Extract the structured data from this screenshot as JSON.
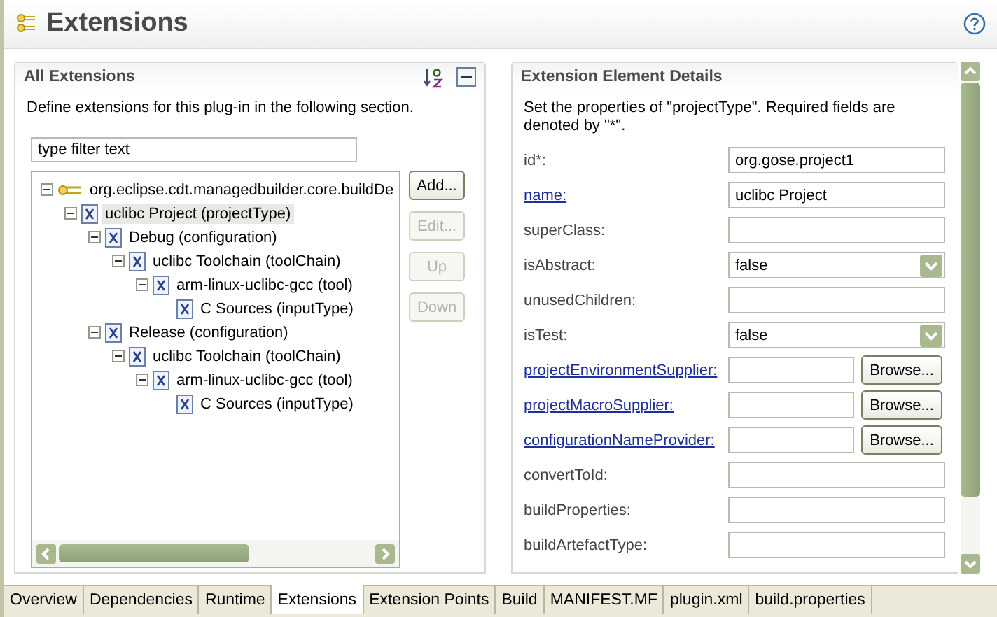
{
  "header": {
    "title": "Extensions"
  },
  "all_extensions": {
    "title": "All Extensions",
    "description": "Define extensions for this plug-in in the following section.",
    "filter": {
      "value": "type filter text"
    },
    "tree": [
      {
        "label": "org.eclipse.cdt.managedbuilder.core.buildDe",
        "kind": "extension",
        "expanded": true,
        "selected": false,
        "children": [
          {
            "label": "uclibc Project (projectType)",
            "kind": "element",
            "expanded": true,
            "selected": true,
            "children": [
              {
                "label": "Debug (configuration)",
                "kind": "element",
                "expanded": true,
                "selected": false,
                "children": [
                  {
                    "label": "uclibc Toolchain (toolChain)",
                    "kind": "element",
                    "expanded": true,
                    "selected": false,
                    "children": [
                      {
                        "label": "arm-linux-uclibc-gcc (tool)",
                        "kind": "element",
                        "expanded": true,
                        "selected": false,
                        "children": [
                          {
                            "label": "C Sources (inputType)",
                            "kind": "element",
                            "selected": false
                          }
                        ]
                      }
                    ]
                  }
                ]
              },
              {
                "label": "Release (configuration)",
                "kind": "element",
                "expanded": true,
                "selected": false,
                "children": [
                  {
                    "label": "uclibc Toolchain (toolChain)",
                    "kind": "element",
                    "expanded": true,
                    "selected": false,
                    "children": [
                      {
                        "label": "arm-linux-uclibc-gcc (tool)",
                        "kind": "element",
                        "expanded": true,
                        "selected": false,
                        "children": [
                          {
                            "label": "C Sources (inputType)",
                            "kind": "element",
                            "selected": false
                          }
                        ]
                      }
                    ]
                  }
                ]
              }
            ]
          }
        ]
      }
    ],
    "buttons": [
      {
        "label": "Add...",
        "disabled": false
      },
      {
        "label": "Edit...",
        "disabled": true
      },
      {
        "label": "Up",
        "disabled": true
      },
      {
        "label": "Down",
        "disabled": true
      }
    ]
  },
  "details": {
    "title": "Extension Element Details",
    "description": "Set the properties of \"projectType\". Required fields are denoted by \"*\".",
    "fields": [
      {
        "label": "id*:",
        "link": false,
        "kind": "text",
        "value": "org.gose.project1"
      },
      {
        "label": "name:",
        "link": true,
        "kind": "text",
        "value": "uclibc Project"
      },
      {
        "label": "superClass:",
        "link": false,
        "kind": "text"
      },
      {
        "label": "isAbstract:",
        "link": false,
        "kind": "combo",
        "value": "false"
      },
      {
        "label": "unusedChildren:",
        "link": false,
        "kind": "text"
      },
      {
        "label": "isTest:",
        "link": false,
        "kind": "combo",
        "value": "false"
      },
      {
        "label": "projectEnvironmentSupplier:",
        "link": true,
        "kind": "browse",
        "button": "Browse..."
      },
      {
        "label": "projectMacroSupplier:",
        "link": true,
        "kind": "browse",
        "button": "Browse..."
      },
      {
        "label": "configurationNameProvider:",
        "link": true,
        "kind": "browse",
        "button": "Browse..."
      },
      {
        "label": "convertToId:",
        "link": false,
        "kind": "text"
      },
      {
        "label": "buildProperties:",
        "link": false,
        "kind": "text"
      },
      {
        "label": "buildArtefactType:",
        "link": false,
        "kind": "text"
      }
    ]
  },
  "tabs": [
    {
      "label": "Overview",
      "selected": false
    },
    {
      "label": "Dependencies",
      "selected": false
    },
    {
      "label": "Runtime",
      "selected": false
    },
    {
      "label": "Extensions",
      "selected": true
    },
    {
      "label": "Extension Points",
      "selected": false
    },
    {
      "label": "Build",
      "selected": false
    },
    {
      "label": "MANIFEST.MF",
      "selected": false
    },
    {
      "label": "plugin.xml",
      "selected": false
    },
    {
      "label": "build.properties",
      "selected": false
    }
  ]
}
